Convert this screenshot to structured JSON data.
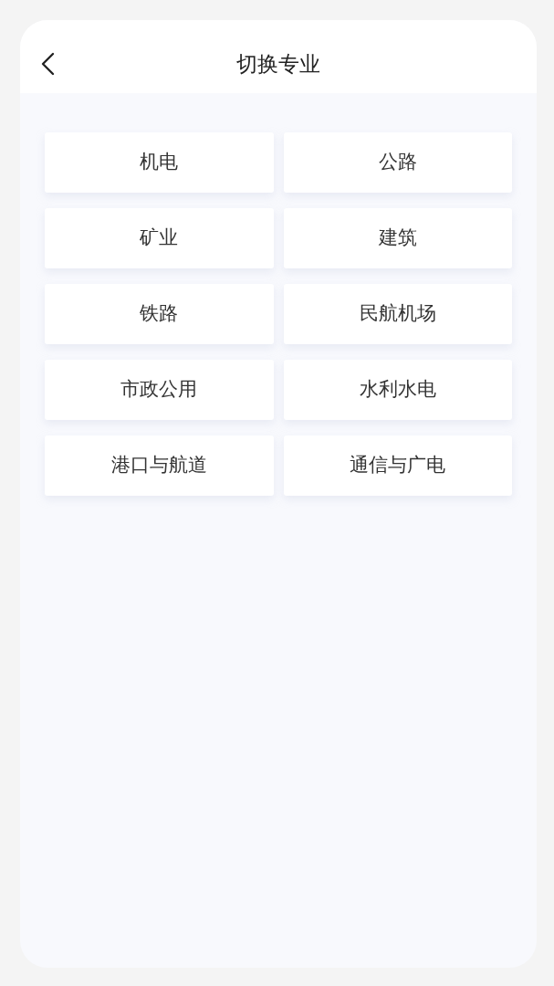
{
  "header": {
    "title": "切换专业"
  },
  "options": [
    {
      "label": "机电"
    },
    {
      "label": "公路"
    },
    {
      "label": "矿业"
    },
    {
      "label": "建筑"
    },
    {
      "label": "铁路"
    },
    {
      "label": "民航机场"
    },
    {
      "label": "市政公用"
    },
    {
      "label": "水利水电"
    },
    {
      "label": "港口与航道"
    },
    {
      "label": "通信与广电"
    }
  ]
}
